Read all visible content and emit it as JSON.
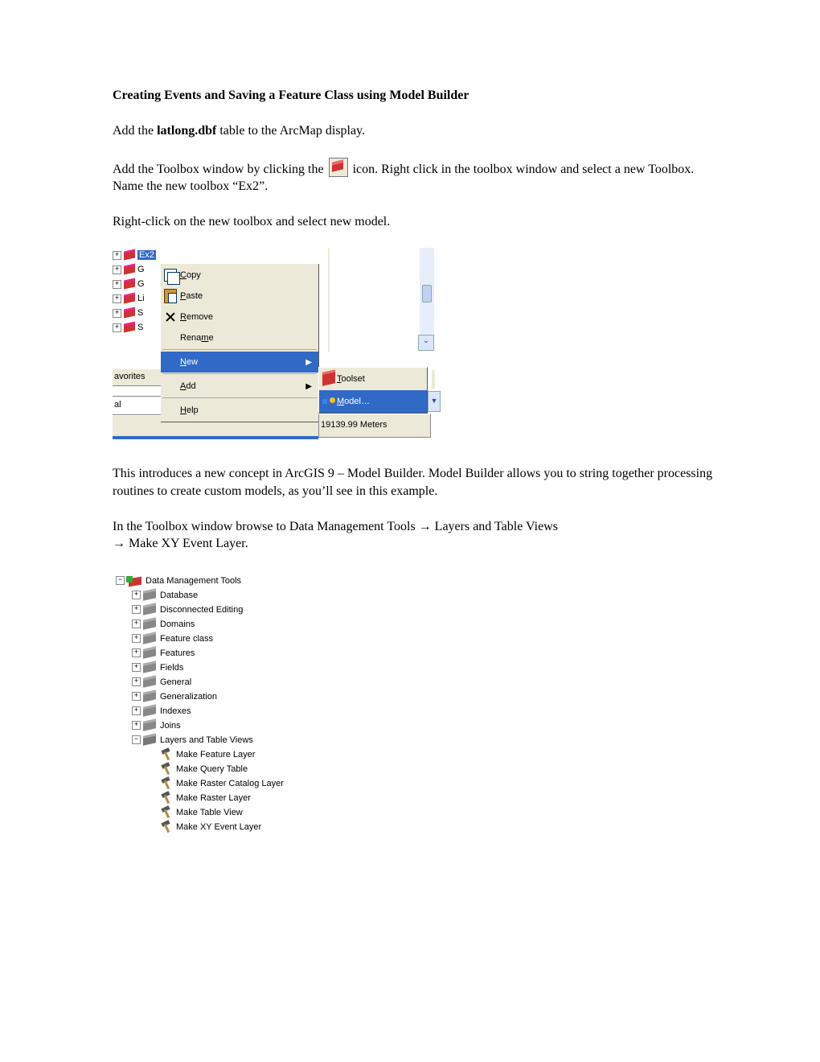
{
  "title": "Creating Events and Saving a Feature Class using Model Builder",
  "p1_a": "Add the ",
  "p1_b": "latlong.dbf",
  "p1_c": " table to the ArcMap display.",
  "p2_a": "Add the Toolbox window by clicking the ",
  "p2_b": " icon.  Right click in the toolbox window and select a new Toolbox.  Name the new toolbox “Ex2”.",
  "p3": "Right-click on the new toolbox and select new model.",
  "shot1": {
    "treeNodes": [
      "Ex2",
      "G",
      "G",
      "Li",
      "S",
      "S"
    ],
    "favorites": "avorites",
    "al": "al",
    "menu": {
      "copy": "Copy",
      "paste": "Paste",
      "remove": "Remove",
      "rename": "Rename",
      "new": "New",
      "add": "Add",
      "help": "Help"
    },
    "submenu": {
      "toolset": "Toolset",
      "model": "Model…"
    },
    "status": "19139.99 Meters"
  },
  "p4": "This introduces a new concept in ArcGIS 9 – Model Builder.  Model Builder allows you to string together processing routines to create custom models, as you’ll see in this example.",
  "p5_a": "In the Toolbox window browse to Data Management Tools ",
  "p5_b": " Layers and Table Views ",
  "p5_c": " Make XY Event Layer.",
  "arrow": "→",
  "tree": {
    "root": "Data Management Tools",
    "toolsets": [
      "Database",
      "Disconnected Editing",
      "Domains",
      "Feature class",
      "Features",
      "Fields",
      "General",
      "Generalization",
      "Indexes",
      "Joins"
    ],
    "openToolset": "Layers and Table Views",
    "tools": [
      "Make Feature Layer",
      "Make Query Table",
      "Make Raster Catalog Layer",
      "Make Raster Layer",
      "Make Table View",
      "Make XY Event Layer"
    ]
  }
}
